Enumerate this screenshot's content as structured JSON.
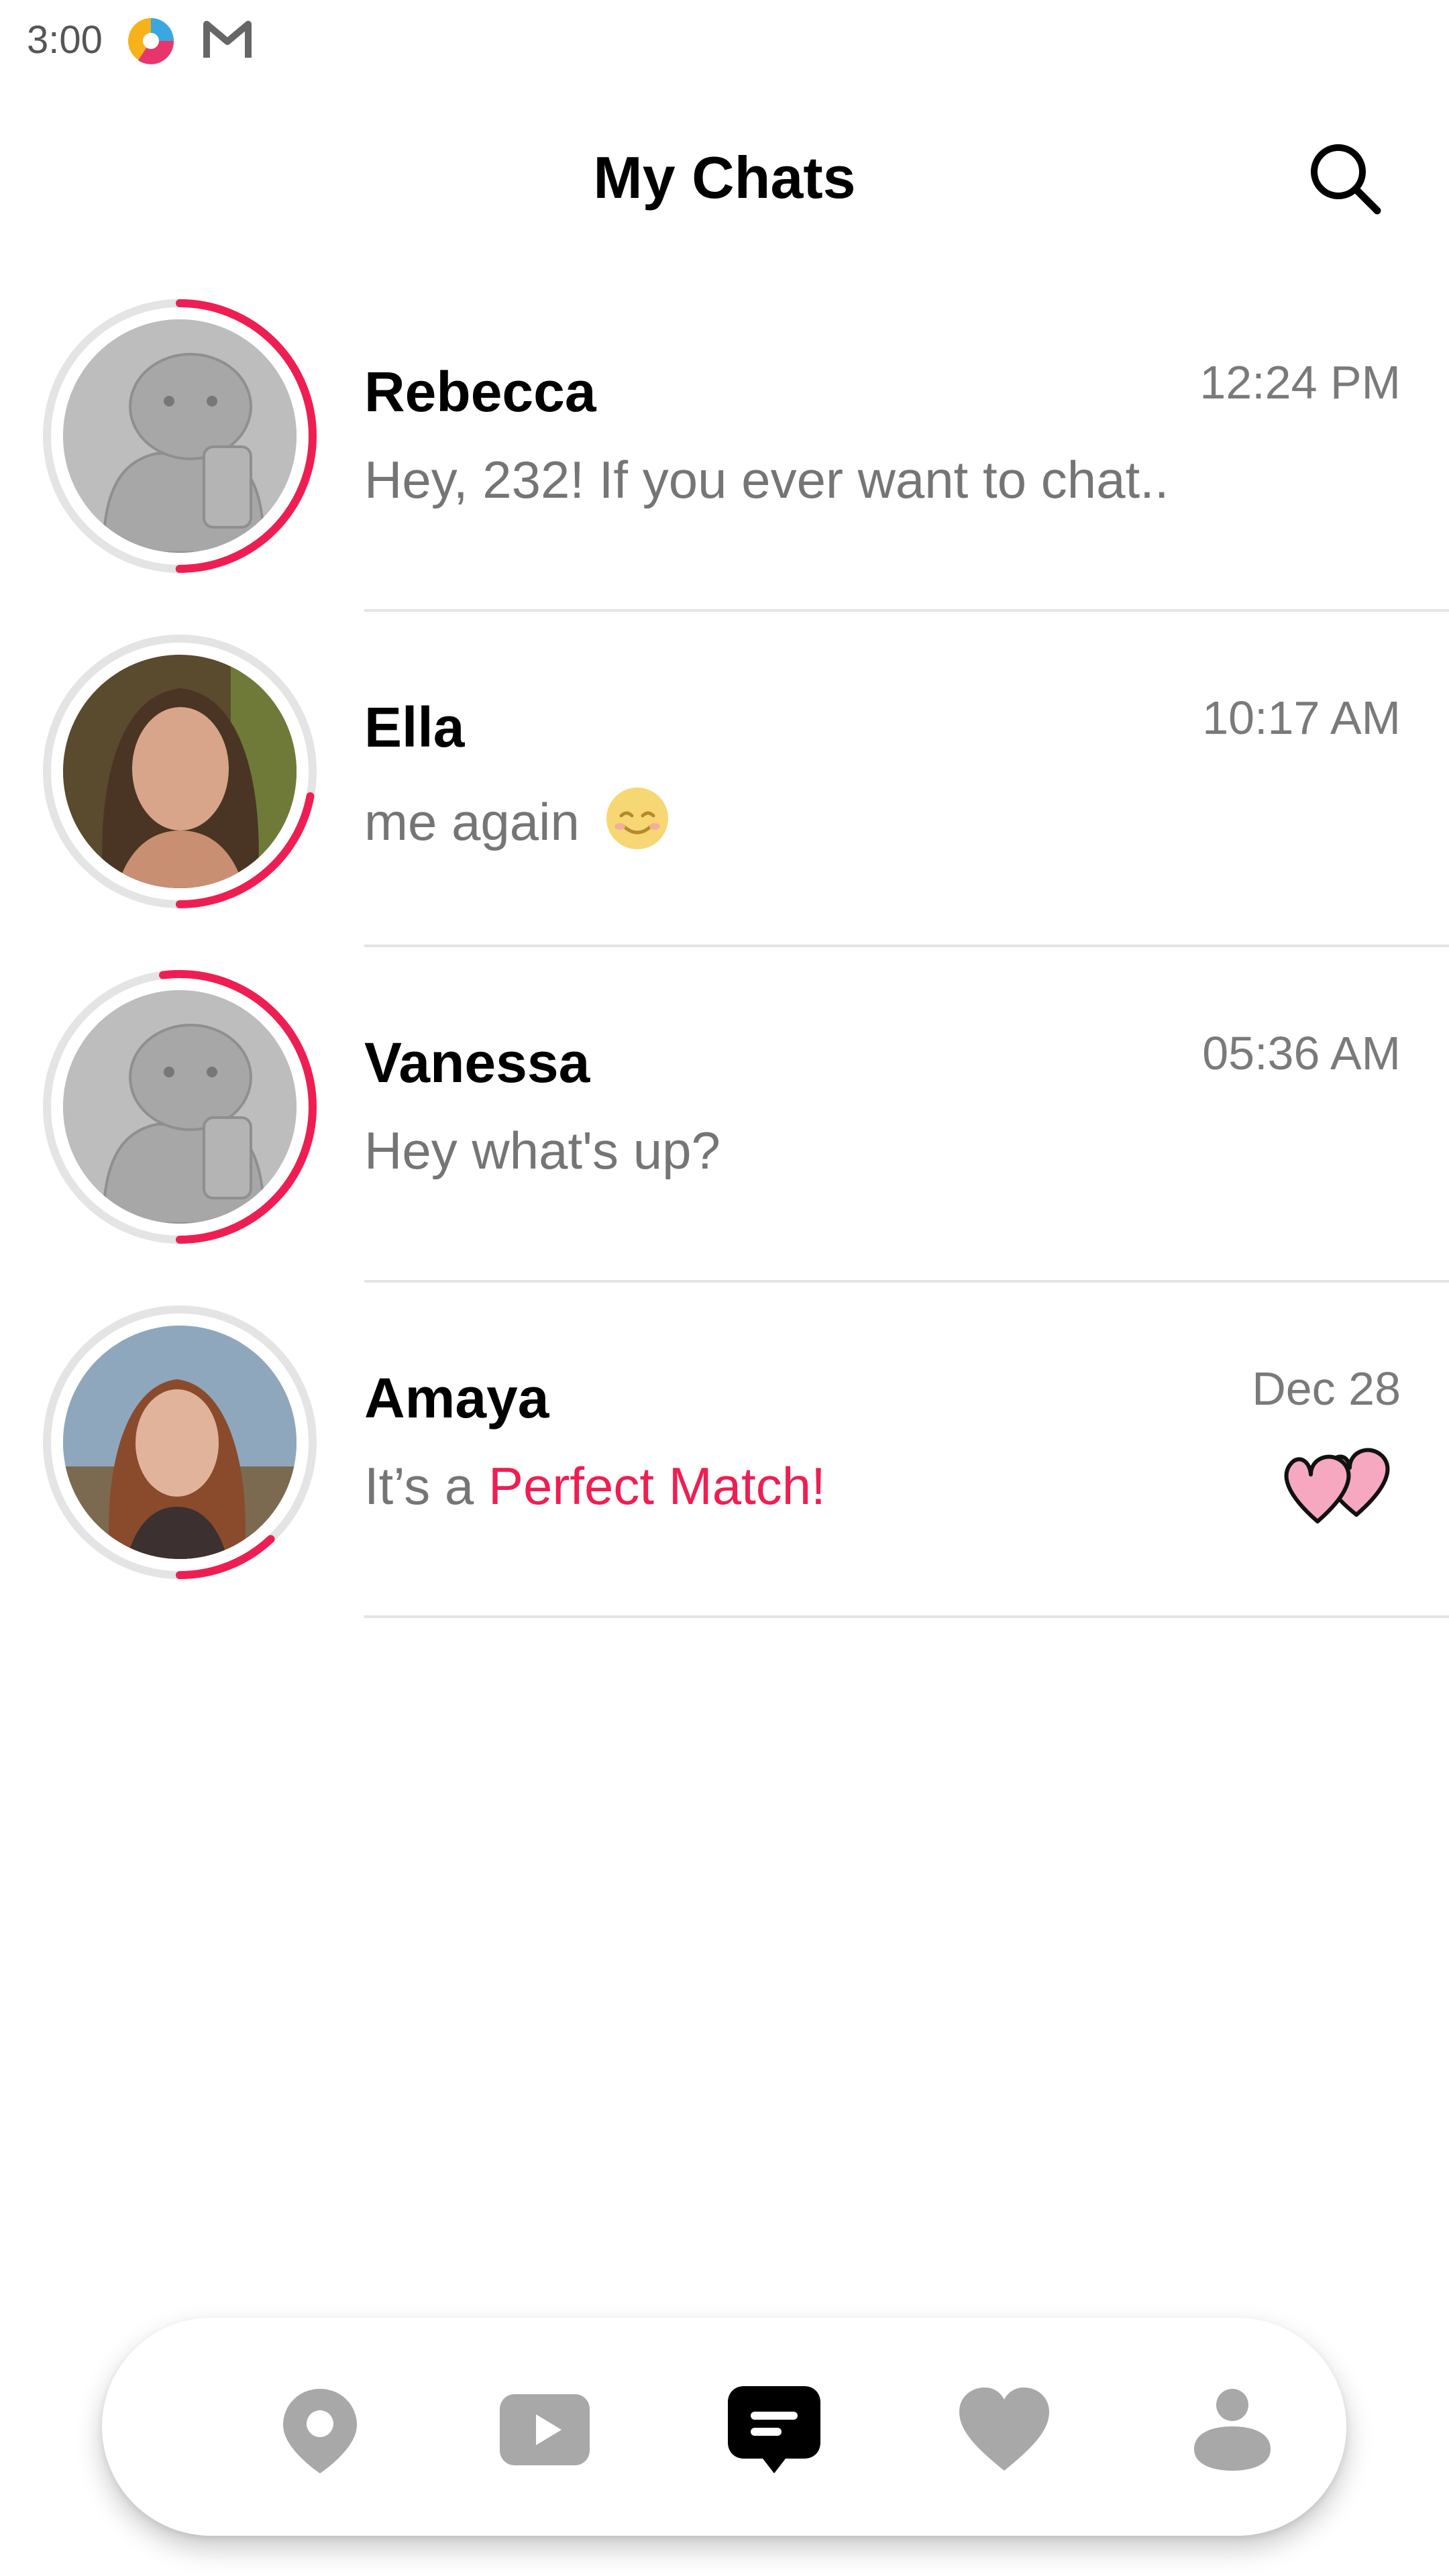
{
  "status_bar": {
    "time": "3:00",
    "icons": [
      "app-logo-icon",
      "gmail-icon"
    ]
  },
  "header": {
    "title": "My Chats",
    "search_icon": "search-icon"
  },
  "colors": {
    "accent": "#ef1e52",
    "ring_track": "#e4e4e4",
    "secondary_text": "#757575",
    "nav_inactive": "#a8a8a8",
    "nav_active": "#000000"
  },
  "chats": [
    {
      "name": "Rebecca",
      "time": "12:24 PM",
      "preview": "Hey, 232! If you ever want to chat..",
      "avatar": "placeholder-avatar",
      "ring_progress": 0.5
    },
    {
      "name": "Ella",
      "time": "10:17 AM",
      "preview": "me again",
      "preview_emoji": "smiling-face-icon",
      "avatar": "photo-avatar",
      "ring_progress": 0.22
    },
    {
      "name": "Vanessa",
      "time": "05:36 AM",
      "preview": "Hey what's up?",
      "avatar": "placeholder-avatar",
      "ring_progress": 0.52
    },
    {
      "name": "Amaya",
      "time": "Dec 28",
      "preview_prefix": "It’s a",
      "preview_highlight": "Perfect Match!",
      "avatar": "photo-avatar",
      "ring_progress": 0.12,
      "badge_icon": "double-heart-icon"
    }
  ],
  "bottom_nav": {
    "items": [
      {
        "icon": "map-pin-icon",
        "active": false
      },
      {
        "icon": "video-play-icon",
        "active": false
      },
      {
        "icon": "chat-bubble-icon",
        "active": true
      },
      {
        "icon": "heart-icon",
        "active": false
      },
      {
        "icon": "profile-icon",
        "active": false
      }
    ]
  }
}
